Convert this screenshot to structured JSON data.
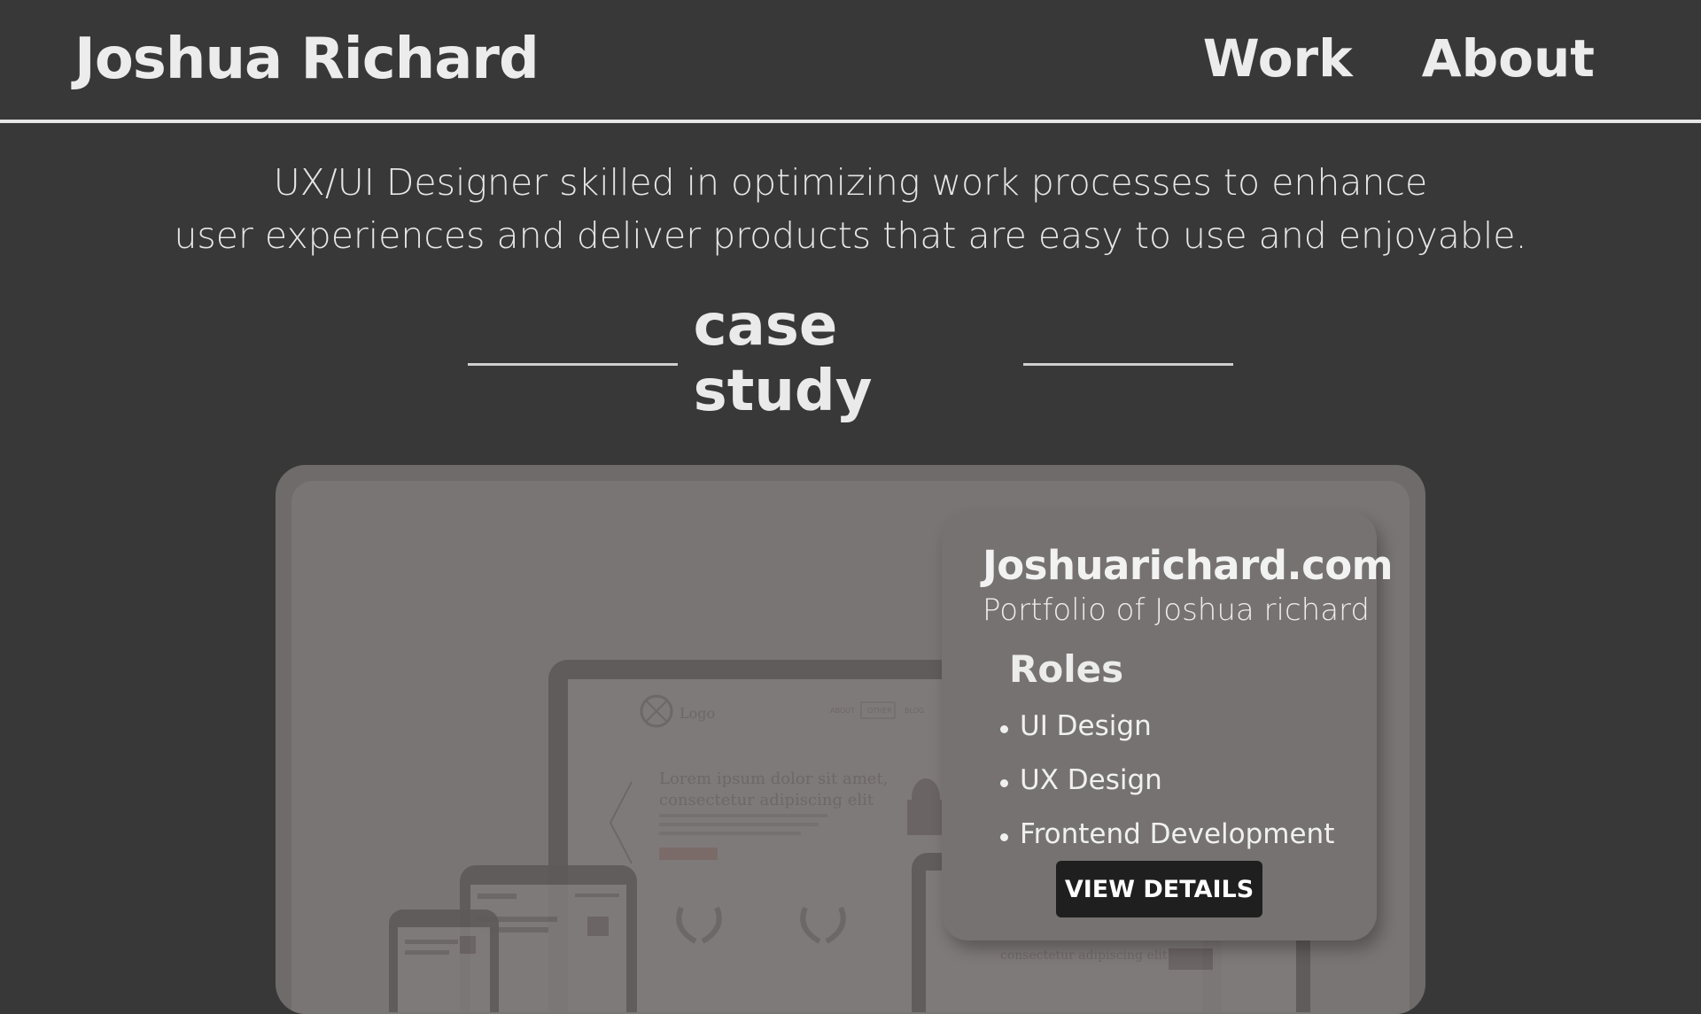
{
  "header": {
    "brand": "Joshua Richard",
    "nav": [
      {
        "label": "Work"
      },
      {
        "label": "About"
      }
    ]
  },
  "intro": {
    "line1": "UX/UI Designer skilled in optimizing work processes to enhance",
    "line2": "user experiences and deliver products that are easy to use and enjoyable."
  },
  "section": {
    "title": "case study"
  },
  "case": {
    "site_name": "Joshuarichard.com",
    "subtitle": "Portfolio of Joshua richard",
    "roles_title": "Roles",
    "roles": [
      "UI Design",
      "UX Design",
      "Frontend Development"
    ],
    "button_label": "VIEW DETAILS"
  },
  "mockup": {
    "logo_text": "Logo",
    "nav_items": [
      "ABOUT",
      "OTHER",
      "BLOG"
    ],
    "headline1": "Lorem ipsum dolor sit amet,",
    "headline2": "consectetur adipiscing elit",
    "tablet_caption": "consectetur adipiscing elit"
  },
  "colors": {
    "page_bg": "#383838",
    "card_bg": "#6f6b6b",
    "panel_bg": "#777272",
    "button_bg": "#1f1f1f"
  }
}
